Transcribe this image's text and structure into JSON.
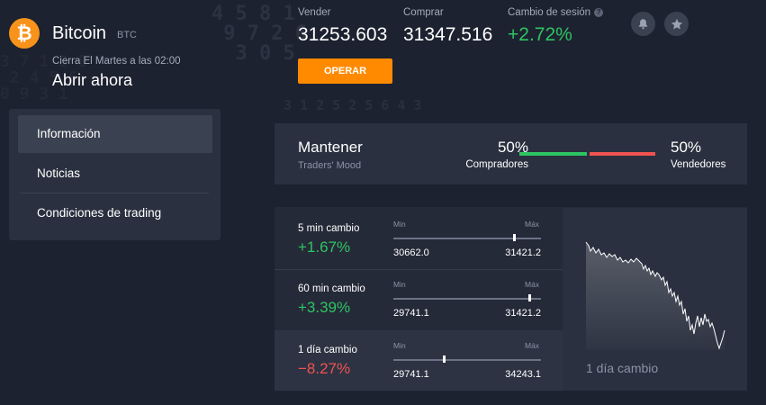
{
  "asset": {
    "name": "Bitcoin",
    "ticker": "BTC",
    "icon": "bitcoin-icon",
    "icon_symbol": "₿",
    "closes_text": "Cierra El Martes a las 02:00",
    "open_label": "Abrir ahora"
  },
  "nav": {
    "items": [
      {
        "label": "Información",
        "active": true
      },
      {
        "label": "Noticias"
      },
      {
        "label": "Condiciones de trading"
      }
    ]
  },
  "quote": {
    "sell_label": "Vender",
    "sell_value": "31253.603",
    "buy_label": "Comprar",
    "buy_value": "31347.516",
    "session_label": "Cambio de sesión",
    "session_help": "?",
    "session_value": "+2.72%",
    "operate_label": "OPERAR"
  },
  "icons": {
    "bell": "bell-icon",
    "star": "star-icon",
    "help": "question-icon"
  },
  "mood": {
    "title": "Mantener",
    "subtitle": "Traders' Mood",
    "buyers_pct": "50%",
    "buyers_label": "Compradores",
    "sellers_pct": "50%",
    "sellers_label": "Vendedores",
    "buyers_share": 0.5
  },
  "changes": [
    {
      "label": "5 min cambio",
      "value": "+1.67%",
      "min_label": "Min",
      "max_label": "Máx",
      "min": "30662.0",
      "max": "31421.2",
      "position": 0.82,
      "direction": "up"
    },
    {
      "label": "60 min cambio",
      "value": "+3.39%",
      "min_label": "Min",
      "max_label": "Máx",
      "min": "29741.1",
      "max": "31421.2",
      "position": 0.92,
      "direction": "up"
    },
    {
      "label": "1 día cambio",
      "value": "−8.27%",
      "min_label": "Min",
      "max_label": "Máx",
      "min": "29741.1",
      "max": "34243.1",
      "position": 0.34,
      "direction": "down"
    }
  ],
  "chart": {
    "label": "1 día cambio"
  },
  "colors": {
    "accent": "#ff8a00",
    "positive": "#2ec463",
    "negative": "#ef5350",
    "bitcoin": "#f7931a"
  }
}
